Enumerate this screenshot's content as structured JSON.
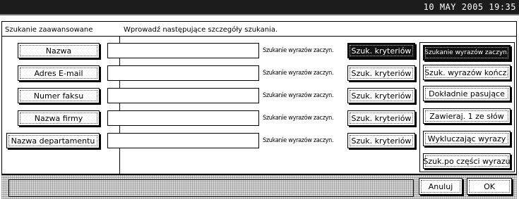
{
  "status_bar": {
    "datetime": "10 MAY   2005 19:35"
  },
  "panel": {
    "title": "Szukanie zaawansowane",
    "instructions": "Wprowadź następujące szczegóły szukania."
  },
  "rows": [
    {
      "field_label": "Nazwa",
      "field_value": "",
      "condition": "Szukanie wyrazów zaczyn.",
      "criteria_button": "Szuk. kryteriów",
      "criteria_selected": true
    },
    {
      "field_label": "Adres E-mail",
      "field_value": "",
      "condition": "Szukanie wyrazów zaczyn.",
      "criteria_button": "Szuk. kryteriów",
      "criteria_selected": false
    },
    {
      "field_label": "Numer faksu",
      "field_value": "",
      "condition": "Szukanie wyrazów zaczyn.",
      "criteria_button": "Szuk. kryteriów",
      "criteria_selected": false
    },
    {
      "field_label": "Nazwa firmy",
      "field_value": "",
      "condition": "Szukanie wyrazów zaczyn.",
      "criteria_button": "Szuk. kryteriów",
      "criteria_selected": false
    },
    {
      "field_label": "Nazwa departamentu",
      "field_value": "",
      "condition": "Szukanie wyrazów zaczyn.",
      "criteria_button": "Szuk. kryteriów",
      "criteria_selected": false
    }
  ],
  "criteria_options": [
    {
      "label": "Szukanie wyrazów zaczyn.",
      "selected": true
    },
    {
      "label": "Szuk. wyrazów kończ.",
      "selected": false
    },
    {
      "label": "Dokładnie pasujące",
      "selected": false
    },
    {
      "label": "Zawieraj. 1 ze słów",
      "selected": false
    },
    {
      "label": "Wykluczając wyrazy",
      "selected": false
    },
    {
      "label": "Szuk.po części wyrazu",
      "selected": false
    }
  ],
  "footer": {
    "cancel_label": "Anuluj",
    "ok_label": "OK"
  },
  "colors": {
    "selected_bg": "#111111",
    "panel_border": "#000000",
    "top_bar": "#1c1c1c"
  }
}
